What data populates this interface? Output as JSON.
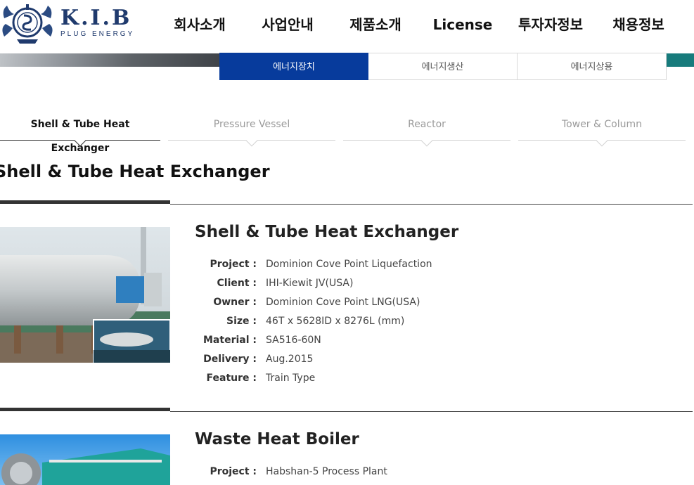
{
  "header": {
    "logo_main": "K.I.B",
    "logo_sub": "PLUG ENERGY",
    "nav": [
      "회사소개",
      "사업안내",
      "제품소개",
      "License",
      "투자자정보",
      "채용정보"
    ]
  },
  "subnav": [
    "에너지장치",
    "에너지생산",
    "에너지상용"
  ],
  "tabs": [
    "Shell & Tube Heat Exchanger",
    "Pressure Vessel",
    "Reactor",
    "Tower & Column"
  ],
  "section_title": "Shell & Tube Heat Exchanger",
  "products": [
    {
      "name": "Shell & Tube Heat Exchanger",
      "specs": [
        {
          "label": "Project :",
          "value": "Dominion Cove Point Liquefaction"
        },
        {
          "label": "Client :",
          "value": "IHI-Kiewit JV(USA)"
        },
        {
          "label": "Owner :",
          "value": "Dominion Cove Point LNG(USA)"
        },
        {
          "label": "Size :",
          "value": "46T x 5628ID x 8276L (mm)"
        },
        {
          "label": "Material :",
          "value": "SA516-60N"
        },
        {
          "label": "Delivery :",
          "value": "Aug.2015"
        },
        {
          "label": "Feature :",
          "value": "Train Type"
        }
      ]
    },
    {
      "name": "Waste Heat Boiler",
      "specs": [
        {
          "label": "Project :",
          "value": "Habshan-5 Process Plant"
        }
      ]
    }
  ],
  "colors": {
    "brand_navy": "#1f3a6d",
    "active_tab": "#073b9c",
    "banner_teal": "#177b7c"
  }
}
